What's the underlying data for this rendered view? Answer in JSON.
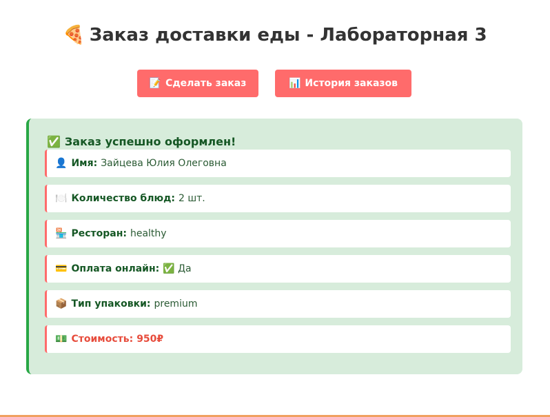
{
  "header": {
    "title_icon": "🍕",
    "title": "Заказ доставки еды - Лабораторная 3"
  },
  "nav": {
    "order_icon": "📝",
    "order_label": "Сделать заказ",
    "history_icon": "📊",
    "history_label": "История заказов"
  },
  "result": {
    "icon": "✅",
    "title": "Заказ успешно оформлен!",
    "rows": [
      {
        "icon": "👤",
        "label": "Имя:",
        "value": "Зайцева Юлия Олеговна"
      },
      {
        "icon": "🍽️",
        "label": "Количество блюд:",
        "value": "2 шт."
      },
      {
        "icon": "🏪",
        "label": "Ресторан:",
        "value": "healthy"
      },
      {
        "icon": "💳",
        "label": "Оплата онлайн:",
        "value": "✅ Да"
      },
      {
        "icon": "📦",
        "label": "Тип упаковки:",
        "value": "premium"
      },
      {
        "icon": "💵",
        "label": "Стоимость:",
        "value": "950₽"
      }
    ]
  },
  "colors": {
    "accent": "#ff6b6b",
    "success_border": "#28a745",
    "success_bg": "#d7ecdb",
    "success_text": "#155724",
    "price": "#e74c3c"
  }
}
